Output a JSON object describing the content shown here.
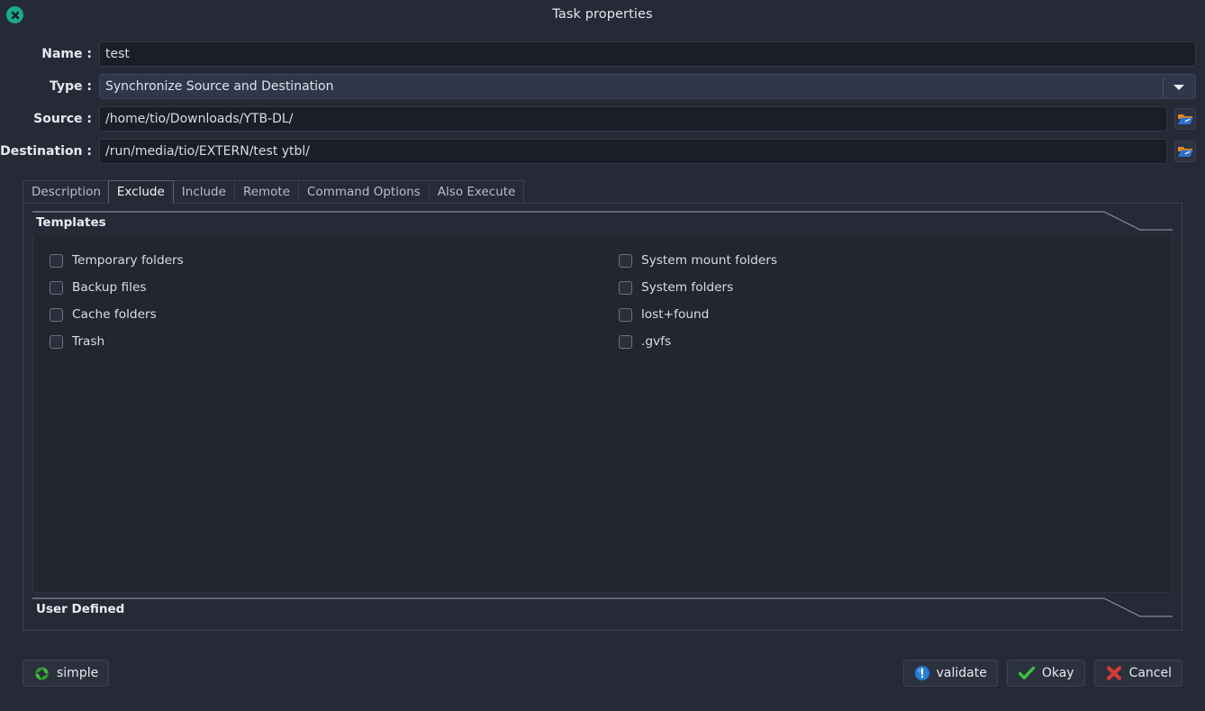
{
  "window": {
    "title": "Task properties",
    "close_icon": "close-circle-icon"
  },
  "form": {
    "name": {
      "label": "Name :",
      "value": "test"
    },
    "type": {
      "label": "Type :",
      "value": "Synchronize Source and Destination",
      "arrow_icon": "chevron-down-icon"
    },
    "source": {
      "label": "Source :",
      "value": "/home/tio/Downloads/YTB-DL/",
      "browse_icon": "folder-open-icon"
    },
    "destination": {
      "label": "Destination :",
      "value": "/run/media/tio/EXTERN/test ytbl/",
      "browse_icon": "folder-open-icon"
    }
  },
  "tabs": [
    {
      "label": "Description",
      "active": false
    },
    {
      "label": "Exclude",
      "active": true
    },
    {
      "label": "Include",
      "active": false
    },
    {
      "label": "Remote",
      "active": false
    },
    {
      "label": "Command Options",
      "active": false
    },
    {
      "label": "Also Execute",
      "active": false
    }
  ],
  "exclude_tab": {
    "templates": {
      "title": "Templates",
      "left_column": [
        {
          "label": "Temporary folders",
          "checked": false
        },
        {
          "label": "Backup files",
          "checked": false
        },
        {
          "label": "Cache folders",
          "checked": false
        },
        {
          "label": "Trash",
          "checked": false
        }
      ],
      "right_column": [
        {
          "label": "System mount folders",
          "checked": false
        },
        {
          "label": "System folders",
          "checked": false
        },
        {
          "label": "lost+found",
          "checked": false
        },
        {
          "label": ".gvfs",
          "checked": false
        }
      ]
    },
    "user_defined": {
      "title": "User Defined"
    }
  },
  "footer": {
    "simple": {
      "label": "simple",
      "icon": "sync-arrows-icon"
    },
    "validate": {
      "label": "validate",
      "icon": "info-circle-icon"
    },
    "okay": {
      "label": "Okay",
      "icon": "check-icon"
    },
    "cancel": {
      "label": "Cancel",
      "icon": "x-mark-icon"
    }
  },
  "colors": {
    "window_bg": "#262a36",
    "input_bg": "#1b1e27",
    "panel_bg": "#24262f",
    "close_accent": "#1bab8f",
    "green": "#3fc03f",
    "blue": "#2a7fd4",
    "red": "#d63a32"
  }
}
